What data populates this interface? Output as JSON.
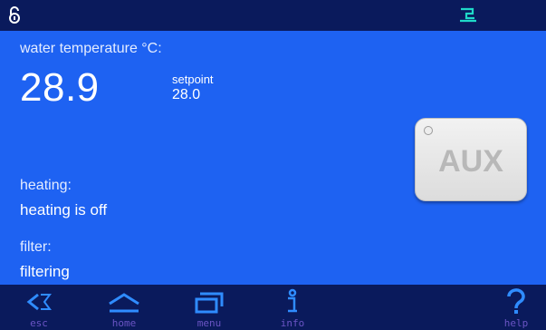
{
  "top_bar": {
    "left_icon": "lock-open-icon",
    "right_icon": "connection-icon"
  },
  "water": {
    "label": "water temperature °C:",
    "value": "28.9",
    "setpoint_label": "setpoint",
    "setpoint_value": "28.0"
  },
  "heating": {
    "label": "heating:",
    "value": "heating is off"
  },
  "filter": {
    "label": "filter:",
    "value": "filtering"
  },
  "aux_button": {
    "label": "AUX"
  },
  "nav": {
    "esc": "esc",
    "home": "home",
    "menu": "menu",
    "info": "info",
    "help": "help"
  },
  "colors": {
    "main_bg": "#1e62f2",
    "bar_bg": "#0a1a5c",
    "icon": "#2f8cff",
    "nav_label": "#6a54c4"
  }
}
